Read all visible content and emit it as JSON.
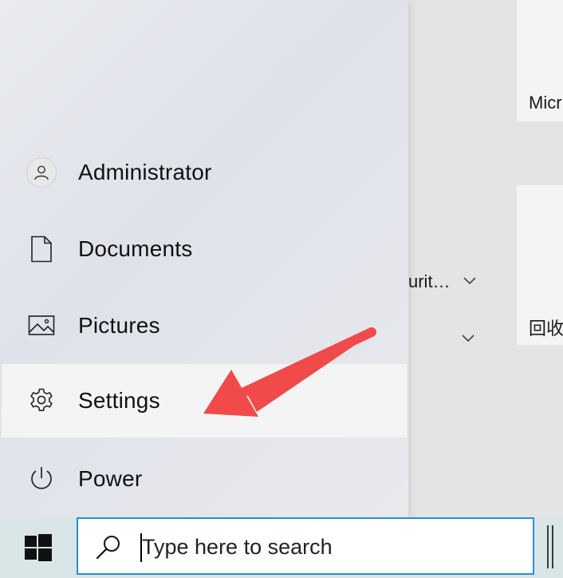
{
  "background_apps": {
    "tile_top_label": "Micr",
    "tile_bottom_label": "回收",
    "list_item_text": "urit…"
  },
  "start_menu": {
    "items": [
      {
        "label": "Administrator",
        "icon": "user-icon"
      },
      {
        "label": "Documents",
        "icon": "document-icon"
      },
      {
        "label": "Pictures",
        "icon": "pictures-icon"
      },
      {
        "label": "Settings",
        "icon": "gear-icon",
        "highlighted": true
      },
      {
        "label": "Power",
        "icon": "power-icon"
      }
    ]
  },
  "taskbar": {
    "search_placeholder": "Type here to search",
    "accent_color": "#2b8ed6"
  },
  "annotation": {
    "arrow_color": "#f04a4a",
    "points_to": "Settings"
  }
}
